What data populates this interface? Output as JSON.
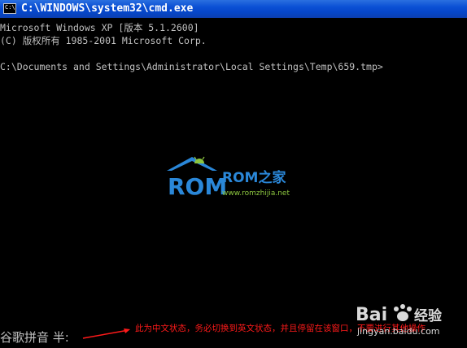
{
  "window": {
    "title": "C:\\WINDOWS\\system32\\cmd.exe",
    "icon_text": "C:\\"
  },
  "console": {
    "lines": [
      "Microsoft Windows XP [版本 5.1.2600]",
      "(C) 版权所有 1985-2001 Microsoft Corp.",
      "",
      "C:\\Documents and Settings\\Administrator\\Local Settings\\Temp\\659.tmp>"
    ]
  },
  "logo": {
    "primary": "ROM",
    "brand": "ROM之家",
    "url": "www.romzhijia.net",
    "colors": {
      "blue": "#2a87d8",
      "green": "#8cc63f"
    }
  },
  "ime": {
    "status": "谷歌拼音 半:"
  },
  "annotation": {
    "text": "此为中文状态，务必切换到英文状态，并且停留在该窗口，不要进行其他操作",
    "color": "#ff1a1a"
  },
  "watermark": {
    "brand": "Bai",
    "brand_suffix": "经验",
    "url": "jingyan.baidu.com"
  }
}
